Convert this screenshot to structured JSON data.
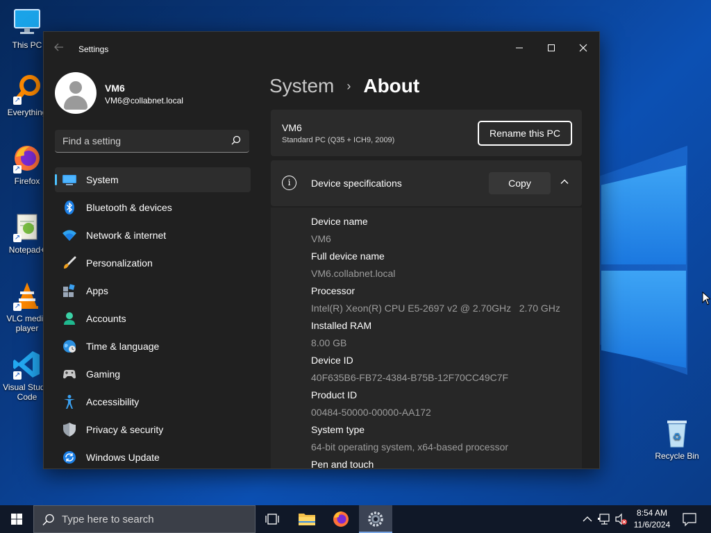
{
  "desktop": {
    "icons": [
      {
        "label": "This PC",
        "icon": "computer-icon"
      },
      {
        "label": "Everything",
        "icon": "everything-search-icon"
      },
      {
        "label": "Firefox",
        "icon": "firefox-icon"
      },
      {
        "label": "Notepad+",
        "icon": "notepad-plus-plus-icon"
      },
      {
        "label": "VLC media player",
        "icon": "vlc-icon"
      },
      {
        "label": "Visual Studio Code",
        "icon": "vscode-icon"
      },
      {
        "label": "Recycle Bin",
        "icon": "recycle-bin-icon"
      }
    ]
  },
  "window": {
    "title": "Settings",
    "controls": {
      "minimize": "—",
      "maximize": "☐",
      "close": "✕"
    }
  },
  "profile": {
    "name": "VM6",
    "email": "VM6@collabnet.local"
  },
  "search": {
    "placeholder": "Find a setting"
  },
  "nav": {
    "items": [
      {
        "label": "System",
        "icon": "system-display-icon",
        "active": true
      },
      {
        "label": "Bluetooth & devices",
        "icon": "bluetooth-icon"
      },
      {
        "label": "Network & internet",
        "icon": "wifi-icon"
      },
      {
        "label": "Personalization",
        "icon": "brush-icon"
      },
      {
        "label": "Apps",
        "icon": "apps-icon"
      },
      {
        "label": "Accounts",
        "icon": "accounts-icon"
      },
      {
        "label": "Time & language",
        "icon": "globe-clock-icon"
      },
      {
        "label": "Gaming",
        "icon": "gamepad-icon"
      },
      {
        "label": "Accessibility",
        "icon": "accessibility-icon"
      },
      {
        "label": "Privacy & security",
        "icon": "shield-icon"
      },
      {
        "label": "Windows Update",
        "icon": "update-icon"
      }
    ]
  },
  "breadcrumb": {
    "parent": "System",
    "separator": "›",
    "current": "About"
  },
  "pc": {
    "name": "VM6",
    "model": "Standard PC (Q35 + ICH9, 2009)",
    "rename_label": "Rename this PC"
  },
  "specs": {
    "title": "Device specifications",
    "copy_label": "Copy",
    "rows": [
      {
        "label": "Device name",
        "value": "VM6"
      },
      {
        "label": "Full device name",
        "value": "VM6.collabnet.local"
      },
      {
        "label": "Processor",
        "value": "Intel(R) Xeon(R) CPU E5-2697 v2 @ 2.70GHz   2.70 GHz"
      },
      {
        "label": "Installed RAM",
        "value": "8.00 GB"
      },
      {
        "label": "Device ID",
        "value": "40F635B6-FB72-4384-B75B-12F70CC49C7F"
      },
      {
        "label": "Product ID",
        "value": "00484-50000-00000-AA172"
      },
      {
        "label": "System type",
        "value": "64-bit operating system, x64-based processor"
      },
      {
        "label": "Pen and touch",
        "value": ""
      }
    ]
  },
  "taskbar": {
    "search_placeholder": "Type here to search",
    "time": "8:54 AM",
    "date": "11/6/2024"
  },
  "colors": {
    "accent": "#4cc2ff",
    "window_bg": "#202020",
    "card_bg": "#2b2b2b"
  }
}
